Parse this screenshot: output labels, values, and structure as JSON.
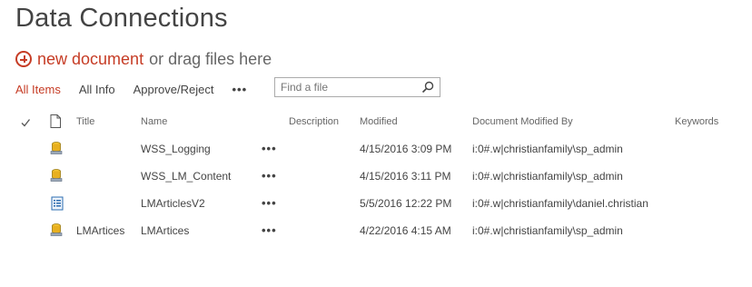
{
  "page": {
    "title": "Data Connections"
  },
  "newdoc": {
    "link_text": "new document",
    "rest_text": "or drag files here"
  },
  "views": {
    "items": [
      "All Items",
      "All Info",
      "Approve/Reject"
    ],
    "more": "•••"
  },
  "search": {
    "placeholder": "Find a file",
    "value": ""
  },
  "columns": {
    "title": "Title",
    "name": "Name",
    "description": "Description",
    "modified": "Modified",
    "modified_by": "Document Modified By",
    "keywords": "Keywords"
  },
  "rows": [
    {
      "icon": "database-icon",
      "title": "",
      "name": "WSS_Logging",
      "menu": "•••",
      "description": "",
      "modified": "4/15/2016 3:09 PM",
      "modified_by": "i:0#.w|christianfamily\\sp_admin"
    },
    {
      "icon": "database-icon",
      "title": "",
      "name": "WSS_LM_Content",
      "menu": "•••",
      "description": "",
      "modified": "4/15/2016 3:11 PM",
      "modified_by": "i:0#.w|christianfamily\\sp_admin"
    },
    {
      "icon": "document-list-icon",
      "title": "",
      "name": "LMArticlesV2",
      "menu": "•••",
      "description": "",
      "modified": "5/5/2016 12:22 PM",
      "modified_by": "i:0#.w|christianfamily\\daniel.christian"
    },
    {
      "icon": "database-icon",
      "title": "LMArtices",
      "name": "LMArtices",
      "menu": "•••",
      "description": "",
      "modified": "4/22/2016 4:15 AM",
      "modified_by": "i:0#.w|christianfamily\\sp_admin"
    }
  ],
  "colors": {
    "accent": "#c63c25",
    "text": "#444444",
    "header": "#666666"
  }
}
